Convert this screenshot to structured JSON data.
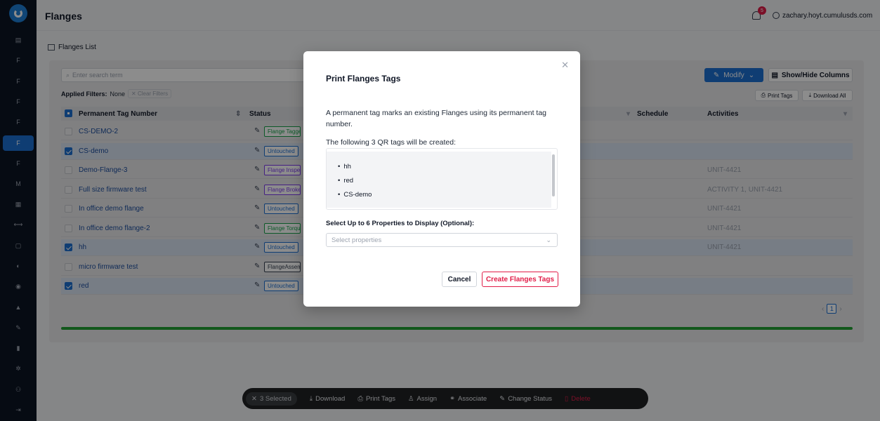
{
  "app": {
    "page_title": "Flanges",
    "notifications_count": "5",
    "user": "zachary.hoyt.cumulusds.com"
  },
  "sidebar": {
    "items": [
      {
        "label": "▤",
        "icon": "grid-icon"
      },
      {
        "label": "F",
        "icon": "letter-f-icon"
      },
      {
        "label": "F",
        "icon": "letter-f-icon"
      },
      {
        "label": "F",
        "icon": "letter-f-icon"
      },
      {
        "label": "F",
        "icon": "letter-f-icon"
      },
      {
        "label": "F",
        "icon": "letter-f-icon",
        "active": true
      },
      {
        "label": "F",
        "icon": "letter-f-icon"
      },
      {
        "label": "M",
        "icon": "letter-m-icon"
      },
      {
        "label": "▦",
        "icon": "calendar-icon"
      },
      {
        "label": "⟷",
        "icon": "link-icon"
      },
      {
        "label": "▢",
        "icon": "document-icon"
      },
      {
        "label": "◐",
        "icon": "chart-icon"
      },
      {
        "label": "◉",
        "icon": "eye-icon"
      },
      {
        "label": "▲",
        "icon": "warning-icon"
      },
      {
        "label": "✎",
        "icon": "wrench-icon"
      },
      {
        "label": "▮",
        "icon": "clipboard-icon"
      },
      {
        "label": "✲",
        "icon": "gear-icon"
      },
      {
        "label": "⚇",
        "icon": "users-icon"
      },
      {
        "label": "⇥",
        "icon": "logout-icon"
      }
    ]
  },
  "panel": {
    "title": "Flanges List",
    "search_placeholder": "Enter search term",
    "applied_filters_label": "Applied Filters:",
    "applied_filters_value": "None",
    "clear_filters": "Clear Filters",
    "modify_label": "Modify",
    "show_hide_label": "Show/Hide Columns",
    "print_tags_label": "Print Tags",
    "download_all_label": "Download All"
  },
  "table": {
    "headers": {
      "tag": "Permanent Tag Number",
      "status": "Status",
      "schedule": "Schedule",
      "activities": "Activities"
    },
    "rows": [
      {
        "name": "CS-DEMO-2",
        "status": "Flange Tagged",
        "status_color": "#16a34a",
        "activities": "",
        "selected": false
      },
      {
        "name": "CS-demo",
        "status": "Untouched",
        "status_color": "#1d6fd1",
        "activities": "",
        "selected": true
      },
      {
        "name": "Demo-Flange-3",
        "status": "Flange Inspected",
        "status_color": "#7c3aed",
        "activities": "UNIT-4421",
        "selected": false
      },
      {
        "name": "Full size firmware test",
        "status": "Flange Broken",
        "status_color": "#7c3aed",
        "activities": "ACTIVITY 1, UNIT-4421",
        "selected": false
      },
      {
        "name": "In office demo flange",
        "status": "Untouched",
        "status_color": "#1d6fd1",
        "activities": "UNIT-4421",
        "selected": false
      },
      {
        "name": "In office demo flange-2",
        "status": "Flange Torqued",
        "status_color": "#16a34a",
        "activities": "UNIT-4421",
        "selected": false
      },
      {
        "name": "hh",
        "status": "Untouched",
        "status_color": "#1d6fd1",
        "activities": "UNIT-4421",
        "selected": true
      },
      {
        "name": "micro firmware test",
        "status": "FlangeAssembled",
        "status_color": "#374151",
        "activities": "",
        "selected": false
      },
      {
        "name": "red",
        "status": "Untouched",
        "status_color": "#1d6fd1",
        "activities": "",
        "selected": true
      }
    ]
  },
  "pagination": {
    "current": "1"
  },
  "progress": {
    "fraction": 1.0,
    "color": "#22a033"
  },
  "modal": {
    "title": "Print Flanges Tags",
    "description": "A permanent tag marks an existing Flanges using its permanent tag number.",
    "subtitle": "The following 3 QR tags will be created:",
    "tags": [
      "hh",
      "red",
      "CS-demo"
    ],
    "props_label": "Select Up to 6 Properties to Display (Optional):",
    "props_placeholder": "Select properties",
    "cancel_label": "Cancel",
    "create_label": "Create Flanges Tags"
  },
  "action_bar": {
    "selected": "3 Selected",
    "download": "Download",
    "print_tags": "Print Tags",
    "assign": "Assign",
    "associate": "Associate",
    "change_status": "Change Status",
    "delete": "Delete"
  }
}
